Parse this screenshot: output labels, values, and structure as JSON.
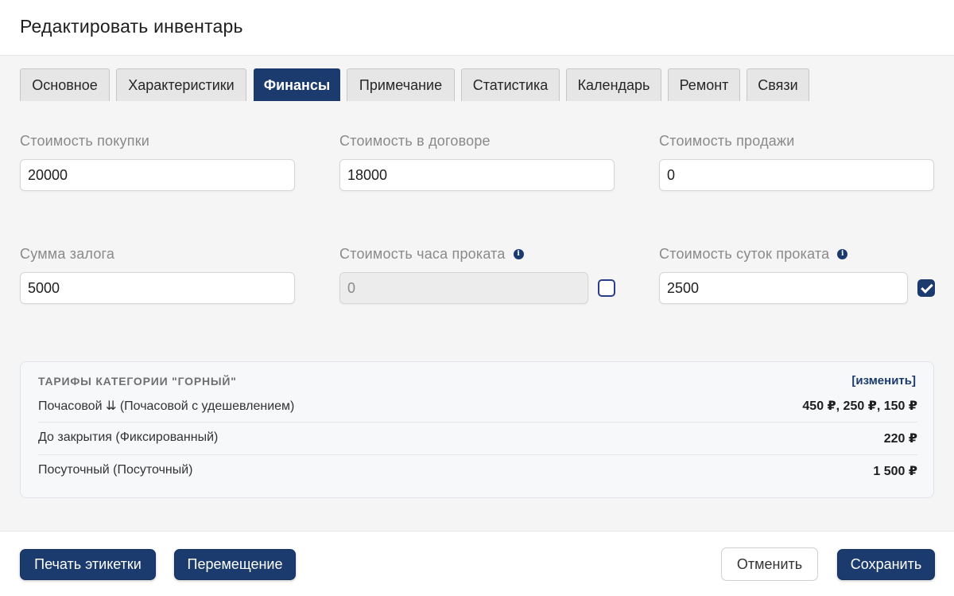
{
  "dialog": {
    "title": "Редактировать инвентарь"
  },
  "tabs": [
    {
      "label": "Основное",
      "active": false
    },
    {
      "label": "Характеристики",
      "active": false
    },
    {
      "label": "Финансы",
      "active": true
    },
    {
      "label": "Примечание",
      "active": false
    },
    {
      "label": "Статистика",
      "active": false
    },
    {
      "label": "Календарь",
      "active": false
    },
    {
      "label": "Ремонт",
      "active": false
    },
    {
      "label": "Связи",
      "active": false
    }
  ],
  "fields": {
    "purchase_price": {
      "label": "Стоимость покупки",
      "value": "20000"
    },
    "contract_price": {
      "label": "Стоимость в договоре",
      "value": "18000"
    },
    "sale_price": {
      "label": "Стоимость продажи",
      "value": "0"
    },
    "deposit": {
      "label": "Сумма залога",
      "value": "5000"
    },
    "hourly_rate": {
      "label": "Стоимость часа проката",
      "value": "0",
      "checked": false,
      "disabled": true
    },
    "daily_rate": {
      "label": "Стоимость суток проката",
      "value": "2500",
      "checked": true
    }
  },
  "tariffs": {
    "title": "ТАРИФЫ КАТЕГОРИИ \"ГОРНЫЙ\"",
    "edit_label": "[изменить]",
    "rows": [
      {
        "name": "Почасовой ⇊ (Почасовой с удешевлением)",
        "value": "450 ₽, 250 ₽, 150 ₽"
      },
      {
        "name": "До закрытия (Фиксированный)",
        "value": "220 ₽"
      },
      {
        "name": "Посуточный (Посуточный)",
        "value": "1 500 ₽"
      }
    ]
  },
  "footer": {
    "print_label": "Печать этикетки",
    "move_label": "Перемещение",
    "cancel_label": "Отменить",
    "save_label": "Сохранить"
  },
  "colors": {
    "accent": "#1b3a6e",
    "panel_bg": "#f5f5f5"
  },
  "icons": {
    "info": "info-circle-icon",
    "check": "checkmark-icon"
  }
}
